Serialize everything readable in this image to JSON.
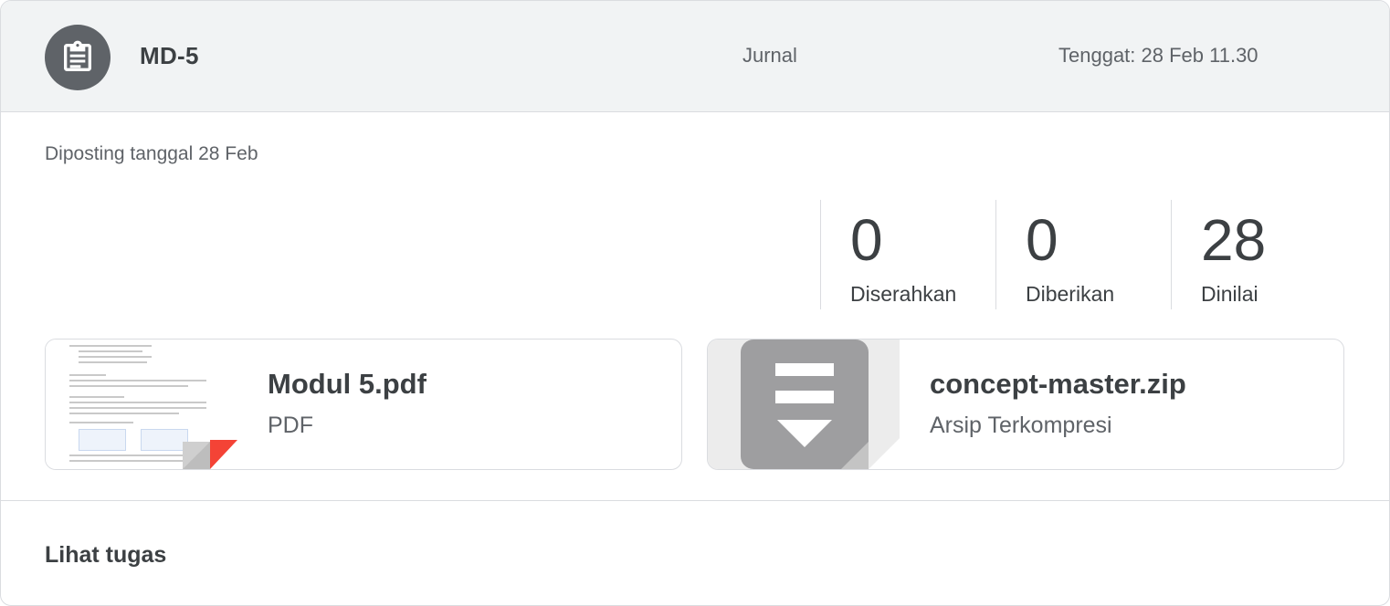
{
  "header": {
    "title": "MD-5",
    "topic": "Jurnal",
    "due": "Tenggat: 28 Feb 11.30",
    "icon": "assignment-icon"
  },
  "posted": "Diposting tanggal 28 Feb",
  "stats": [
    {
      "value": "0",
      "label": "Diserahkan"
    },
    {
      "value": "0",
      "label": "Diberikan"
    },
    {
      "value": "28",
      "label": "Dinilai"
    }
  ],
  "attachments": [
    {
      "name": "Modul 5.pdf",
      "type": "PDF",
      "icon": "pdf-thumbnail",
      "accent": "#f44336"
    },
    {
      "name": "concept-master.zip",
      "type": "Arsip Terkompresi",
      "icon": "zip-archive-icon",
      "accent": "#9e9ea0"
    }
  ],
  "footer": {
    "view_label": "Lihat tugas"
  },
  "colors": {
    "header_bg": "#f1f3f4",
    "icon_bg": "#5f6368",
    "border": "#dadce0"
  }
}
